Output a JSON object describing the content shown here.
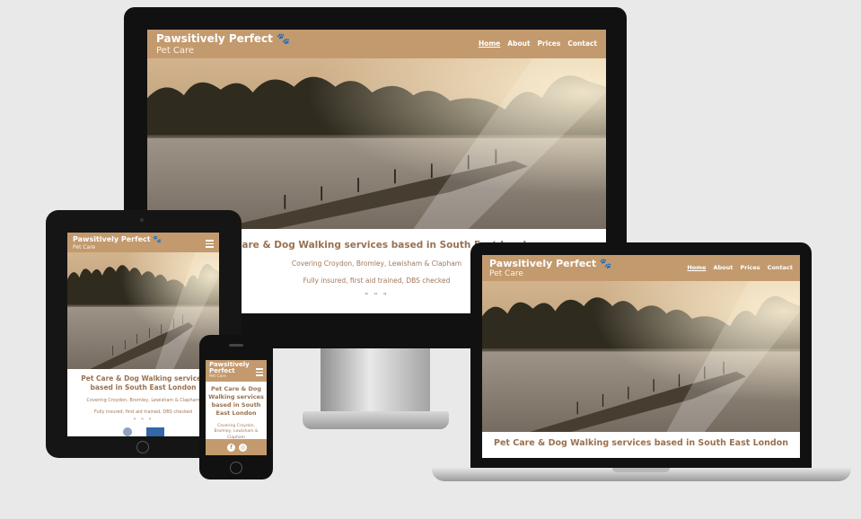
{
  "brand": {
    "title": "Pawsitively Perfect",
    "subtitle": "Pet Care",
    "paw_icon": "paw-icon"
  },
  "nav": {
    "items": [
      "Home",
      "About",
      "Prices",
      "Contact"
    ],
    "active": "Home"
  },
  "hero": {
    "tagline": "Pet Care & Dog Walking services based in South East London",
    "coverage": "Covering Croydon, Bromley, Lewisham & Clapham",
    "credentials": "Fully insured, first aid trained, DBS checked",
    "separator": "\" \" \""
  },
  "social": {
    "facebook_icon": "f",
    "instagram_icon": "◎"
  },
  "colors": {
    "brand_tan": "#c39a6e",
    "text_brown": "#9a7150",
    "background": "#e9e9e9",
    "bezel": "#111111"
  }
}
